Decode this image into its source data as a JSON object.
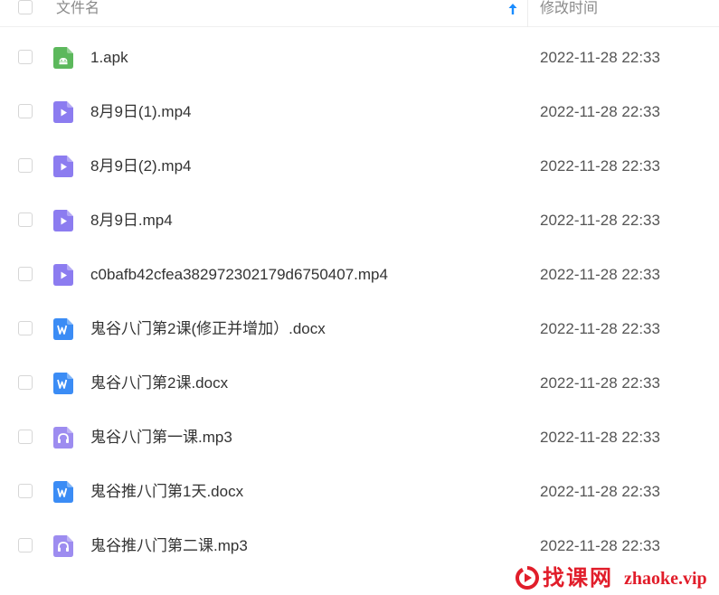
{
  "header": {
    "name_label": "文件名",
    "time_label": "修改时间",
    "sort_icon": "arrow-up-icon",
    "accent_color": "#1a8cff"
  },
  "files": [
    {
      "name": "1.apk",
      "modified": "2022-11-28 22:33",
      "type": "apk",
      "icon": "android-file-icon"
    },
    {
      "name": "8月9日(1).mp4",
      "modified": "2022-11-28 22:33",
      "type": "video",
      "icon": "video-file-icon"
    },
    {
      "name": "8月9日(2).mp4",
      "modified": "2022-11-28 22:33",
      "type": "video",
      "icon": "video-file-icon"
    },
    {
      "name": "8月9日.mp4",
      "modified": "2022-11-28 22:33",
      "type": "video",
      "icon": "video-file-icon"
    },
    {
      "name": "c0bafb42cfea382972302179d6750407.mp4",
      "modified": "2022-11-28 22:33",
      "type": "video",
      "icon": "video-file-icon"
    },
    {
      "name": "鬼谷八门第2课(修正并增加）.docx",
      "modified": "2022-11-28 22:33",
      "type": "word",
      "icon": "word-file-icon"
    },
    {
      "name": "鬼谷八门第2课.docx",
      "modified": "2022-11-28 22:33",
      "type": "word",
      "icon": "word-file-icon"
    },
    {
      "name": "鬼谷八门第一课.mp3",
      "modified": "2022-11-28 22:33",
      "type": "audio",
      "icon": "audio-file-icon"
    },
    {
      "name": "鬼谷推八门第1天.docx",
      "modified": "2022-11-28 22:33",
      "type": "word",
      "icon": "word-file-icon"
    },
    {
      "name": "鬼谷推八门第二课.mp3",
      "modified": "2022-11-28 22:33",
      "type": "audio",
      "icon": "audio-file-icon"
    }
  ],
  "colors": {
    "apk": "#5cb85c",
    "video": "#8c7cf0",
    "word": "#3b8cf5",
    "audio": "#9d8cf0"
  },
  "watermark": {
    "cn": "找课网",
    "en": "zhaoke.vip",
    "color": "#e11d2a"
  }
}
